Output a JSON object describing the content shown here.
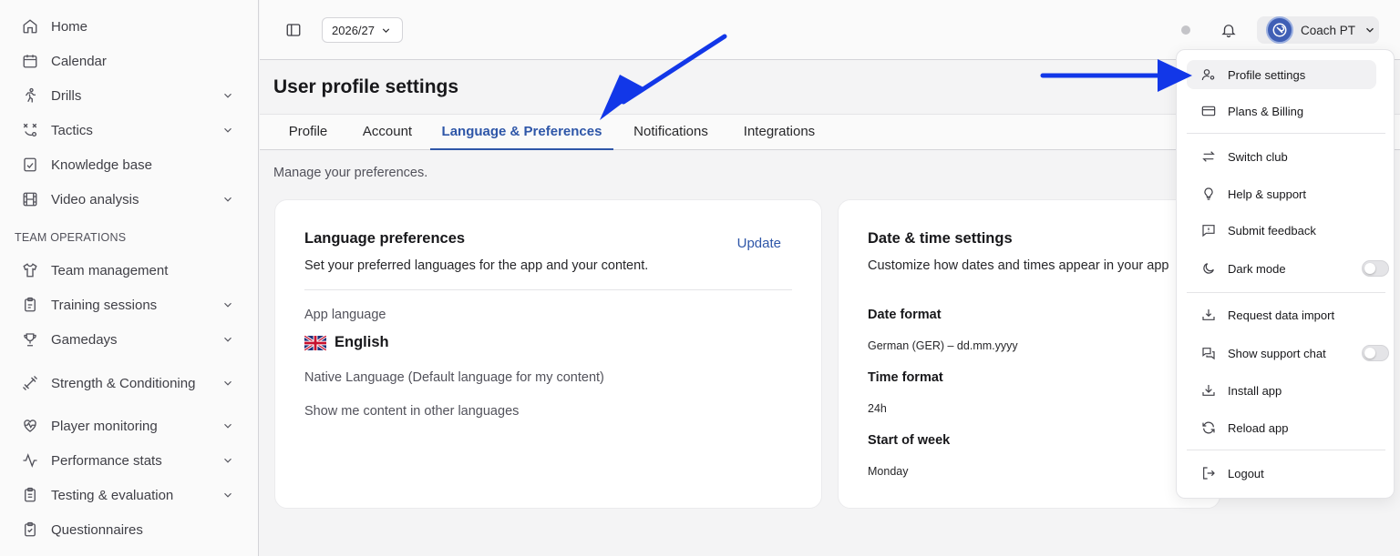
{
  "sidebar": {
    "items": [
      {
        "label": "Home",
        "icon": "home-icon"
      },
      {
        "label": "Calendar",
        "icon": "calendar-icon"
      },
      {
        "label": "Drills",
        "icon": "runner-icon"
      },
      {
        "label": "Tactics",
        "icon": "tactics-icon"
      },
      {
        "label": "Knowledge base",
        "icon": "book-icon"
      },
      {
        "label": "Video analysis",
        "icon": "film-icon"
      }
    ],
    "section_label": "TEAM OPERATIONS",
    "team_items": [
      {
        "label": "Team management",
        "icon": "jersey-icon"
      },
      {
        "label": "Training sessions",
        "icon": "clipboard-icon"
      },
      {
        "label": "Gamedays",
        "icon": "trophy-icon"
      },
      {
        "label": "Strength & Conditioning",
        "icon": "dumbbell-icon"
      },
      {
        "label": "Player monitoring",
        "icon": "heart-pulse-icon"
      },
      {
        "label": "Performance stats",
        "icon": "activity-icon"
      },
      {
        "label": "Testing & evaluation",
        "icon": "clipboard-list-icon"
      },
      {
        "label": "Questionnaires",
        "icon": "clipboard-check-icon"
      }
    ]
  },
  "topbar": {
    "season": "2026/27",
    "user_name": "Coach PT"
  },
  "page": {
    "title": "User profile settings",
    "tabs": [
      "Profile",
      "Account",
      "Language & Preferences",
      "Notifications",
      "Integrations"
    ],
    "active_tab": "Language & Preferences",
    "description": "Manage your preferences."
  },
  "language_card": {
    "title": "Language preferences",
    "subtitle": "Set your preferred languages for the app and your content.",
    "update_label": "Update",
    "app_language_label": "App language",
    "app_language_value": "English",
    "native_language_label": "Native Language (Default language for my content)",
    "other_languages_label": "Show me content in other languages"
  },
  "datetime_card": {
    "title": "Date & time settings",
    "subtitle": "Customize how dates and times appear in your app",
    "date_format_label": "Date format",
    "date_format_value": "German (GER) – dd.mm.yyyy",
    "time_format_label": "Time format",
    "time_format_value": "24h",
    "week_start_label": "Start of week",
    "week_start_value": "Monday"
  },
  "user_menu": {
    "items": [
      {
        "label": "Profile settings",
        "icon": "user-cog-icon"
      },
      {
        "label": "Plans & Billing",
        "icon": "credit-card-icon"
      },
      {
        "label": "Switch club",
        "icon": "switch-arrows-icon"
      },
      {
        "label": "Help & support",
        "icon": "lightbulb-icon"
      },
      {
        "label": "Submit feedback",
        "icon": "feedback-icon"
      },
      {
        "label": "Dark mode",
        "icon": "moon-icon",
        "toggle": false
      },
      {
        "label": "Request data import",
        "icon": "import-icon"
      },
      {
        "label": "Show support chat",
        "icon": "chat-icon",
        "toggle": false
      },
      {
        "label": "Install app",
        "icon": "download-icon"
      },
      {
        "label": "Reload app",
        "icon": "reload-icon"
      },
      {
        "label": "Logout",
        "icon": "logout-icon"
      }
    ]
  },
  "colors": {
    "accent": "#2e56a8",
    "annotation_arrow": "#1237e8"
  }
}
